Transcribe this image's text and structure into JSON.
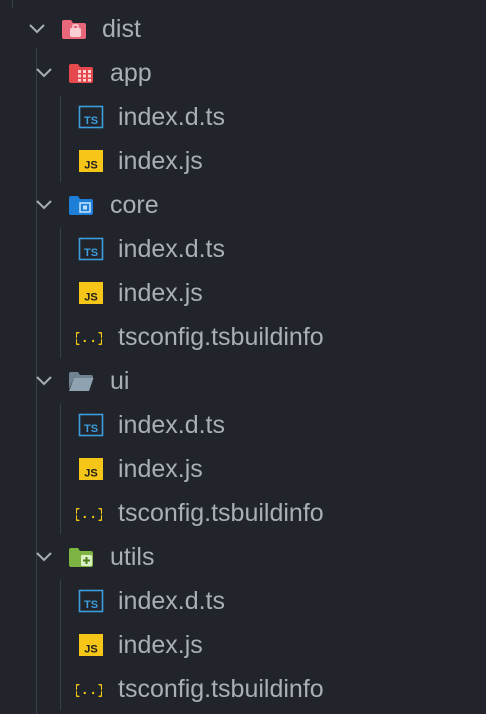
{
  "explorer": {
    "folders": [
      {
        "name": "dist",
        "icon": "folder-dist-icon",
        "color": "#e8677a"
      },
      {
        "name": "app",
        "icon": "folder-app-icon",
        "color": "#e5484d",
        "files": [
          {
            "name": "index.d.ts",
            "icon": "typescript-def-icon"
          },
          {
            "name": "index.js",
            "icon": "javascript-icon"
          }
        ]
      },
      {
        "name": "core",
        "icon": "folder-core-icon",
        "color": "#1e7fd8",
        "files": [
          {
            "name": "index.d.ts",
            "icon": "typescript-def-icon"
          },
          {
            "name": "index.js",
            "icon": "javascript-icon"
          },
          {
            "name": "tsconfig.tsbuildinfo",
            "icon": "json-braces-icon"
          }
        ]
      },
      {
        "name": "ui",
        "icon": "folder-ui-icon",
        "color": "#8fa2b0",
        "files": [
          {
            "name": "index.d.ts",
            "icon": "typescript-def-icon"
          },
          {
            "name": "index.js",
            "icon": "javascript-icon"
          },
          {
            "name": "tsconfig.tsbuildinfo",
            "icon": "json-braces-icon"
          }
        ]
      },
      {
        "name": "utils",
        "icon": "folder-utils-icon",
        "color": "#7cb342",
        "files": [
          {
            "name": "index.d.ts",
            "icon": "typescript-def-icon"
          },
          {
            "name": "index.js",
            "icon": "javascript-icon"
          },
          {
            "name": "tsconfig.tsbuildinfo",
            "icon": "json-braces-icon"
          }
        ]
      }
    ],
    "colors": {
      "background": "#21252b",
      "text": "#a9aeb7",
      "typescript": "#3d9ddd",
      "javascript": "#f5c518",
      "json": "#f5c518"
    }
  }
}
